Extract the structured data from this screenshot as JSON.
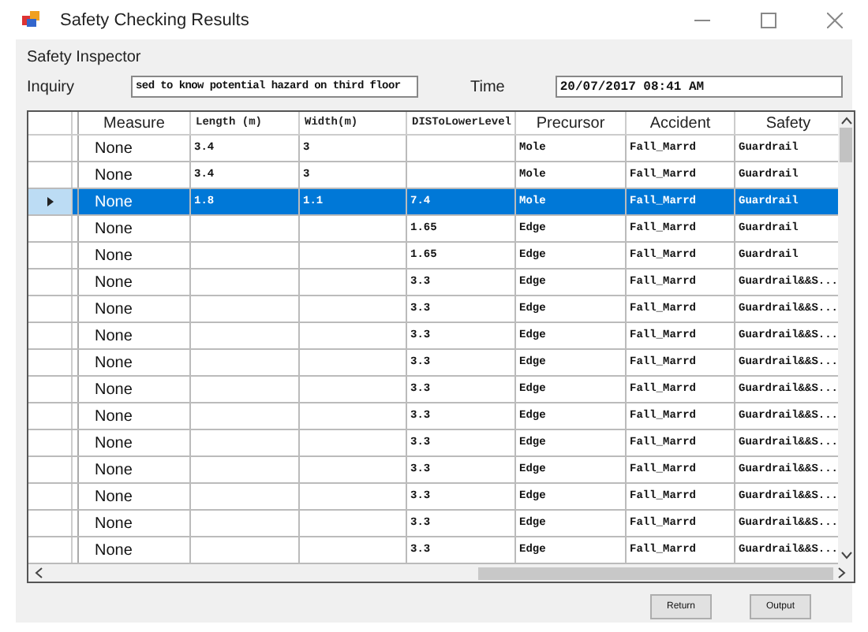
{
  "window": {
    "title": "Safety Checking  Results"
  },
  "group_label": "Safety Inspector",
  "inquiry": {
    "label": "Inquiry",
    "value": "sed to know potential hazard on third floor"
  },
  "time": {
    "label": "Time",
    "value": "20/07/2017 08:41 AM"
  },
  "table": {
    "columns": [
      "Measure",
      "Length (m)",
      "Width(m)",
      "DISToLowerLevel",
      "Precursor",
      "Accident",
      "Safety"
    ],
    "rows": [
      {
        "selected": false,
        "cells": [
          "None",
          "3.4",
          "3",
          "",
          "Mole",
          "Fall_Marrd",
          "Guardrail"
        ]
      },
      {
        "selected": false,
        "cells": [
          "None",
          "3.4",
          "3",
          "",
          "Mole",
          "Fall_Marrd",
          "Guardrail"
        ]
      },
      {
        "selected": true,
        "cells": [
          "None",
          "1.8",
          "1.1",
          "7.4",
          "Mole",
          "Fall_Marrd",
          "Guardrail"
        ]
      },
      {
        "selected": false,
        "cells": [
          "None",
          "",
          "",
          "1.65",
          "Edge",
          "Fall_Marrd",
          "Guardrail"
        ]
      },
      {
        "selected": false,
        "cells": [
          "None",
          "",
          "",
          "1.65",
          "Edge",
          "Fall_Marrd",
          "Guardrail"
        ]
      },
      {
        "selected": false,
        "cells": [
          "None",
          "",
          "",
          "3.3",
          "Edge",
          "Fall_Marrd",
          "Guardrail&&S..."
        ]
      },
      {
        "selected": false,
        "cells": [
          "None",
          "",
          "",
          "3.3",
          "Edge",
          "Fall_Marrd",
          "Guardrail&&S..."
        ]
      },
      {
        "selected": false,
        "cells": [
          "None",
          "",
          "",
          "3.3",
          "Edge",
          "Fall_Marrd",
          "Guardrail&&S..."
        ]
      },
      {
        "selected": false,
        "cells": [
          "None",
          "",
          "",
          "3.3",
          "Edge",
          "Fall_Marrd",
          "Guardrail&&S..."
        ]
      },
      {
        "selected": false,
        "cells": [
          "None",
          "",
          "",
          "3.3",
          "Edge",
          "Fall_Marrd",
          "Guardrail&&S..."
        ]
      },
      {
        "selected": false,
        "cells": [
          "None",
          "",
          "",
          "3.3",
          "Edge",
          "Fall_Marrd",
          "Guardrail&&S..."
        ]
      },
      {
        "selected": false,
        "cells": [
          "None",
          "",
          "",
          "3.3",
          "Edge",
          "Fall_Marrd",
          "Guardrail&&S..."
        ]
      },
      {
        "selected": false,
        "cells": [
          "None",
          "",
          "",
          "3.3",
          "Edge",
          "Fall_Marrd",
          "Guardrail&&S..."
        ]
      },
      {
        "selected": false,
        "cells": [
          "None",
          "",
          "",
          "3.3",
          "Edge",
          "Fall_Marrd",
          "Guardrail&&S..."
        ]
      },
      {
        "selected": false,
        "cells": [
          "None",
          "",
          "",
          "3.3",
          "Edge",
          "Fall_Marrd",
          "Guardrail&&S..."
        ]
      },
      {
        "selected": false,
        "cells": [
          "None",
          "",
          "",
          "3.3",
          "Edge",
          "Fall_Marrd",
          "Guardrail&&S..."
        ]
      }
    ]
  },
  "buttons": [
    "Return",
    "Output"
  ]
}
